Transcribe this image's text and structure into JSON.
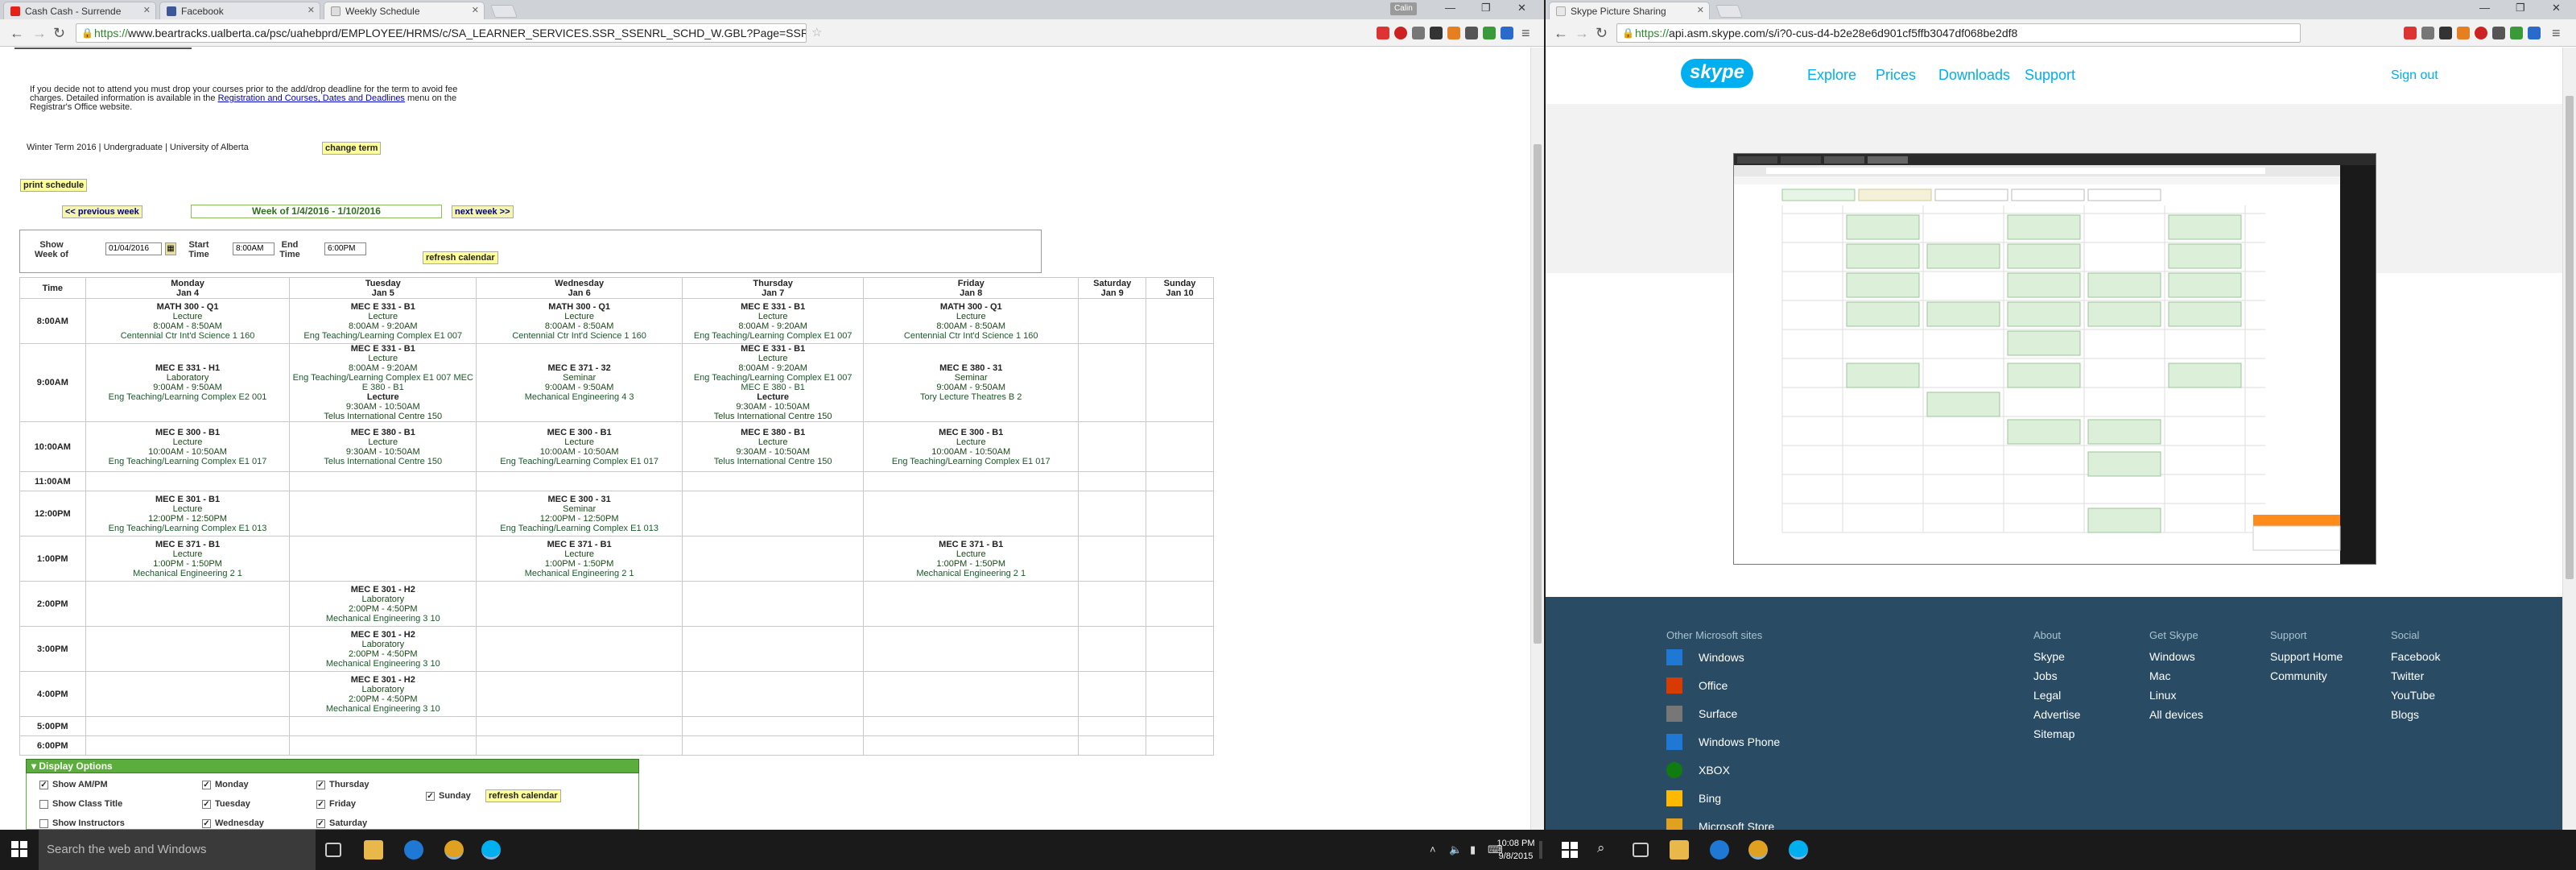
{
  "left_window": {
    "tabs": [
      {
        "label": "Cash Cash - Surrende",
        "icon_color": "#e62117"
      },
      {
        "label": "Facebook",
        "icon_color": "#3b5998"
      },
      {
        "label": "Weekly Schedule",
        "icon_color": "#cccccc"
      }
    ],
    "user_badge": "Calin",
    "url_https": "https://",
    "url_rest": "www.beartracks.ualberta.ca/psc/uahebprd/EMPLOYEE/HRMS/c/SA_LEARNER_SERVICES.SSR_SSENRL_SCHD_W.GBL?Page=SSR_SS_WEEK&Action=A&ExactKeys=Y&ACAD_CAREER=UGRD&AS_OF_DATE=2016-01-04"
  },
  "page": {
    "intro_1": "If you decide not to attend you must drop your courses prior to the add/drop deadline for the term to avoid fee",
    "intro_2": "charges. Detailed information is available in the ",
    "intro_link": "Registration and Courses, Dates and Deadlines",
    "intro_3": " menu on the",
    "intro_4": "Registrar's Office website.",
    "term": "Winter Term 2016 | Undergraduate | University of Alberta",
    "change_term": "change term",
    "print_schedule": "print schedule",
    "prev_week": "<< previous week",
    "week_of": "Week of 1/4/2016 - 1/10/2016",
    "next_week": "next week >>",
    "show_week_label": "Show Week of",
    "show_week_value": "01/04/2016",
    "start_time_label": "Start Time",
    "start_time_value": "8:00AM",
    "end_time_label": "End Time",
    "end_time_value": "6:00PM",
    "refresh": "refresh calendar"
  },
  "schedule": {
    "time_header": "Time",
    "days": [
      {
        "name": "Monday",
        "date": "Jan 4"
      },
      {
        "name": "Tuesday",
        "date": "Jan 5"
      },
      {
        "name": "Wednesday",
        "date": "Jan 6"
      },
      {
        "name": "Thursday",
        "date": "Jan 7"
      },
      {
        "name": "Friday",
        "date": "Jan 8"
      },
      {
        "name": "Saturday",
        "date": "Jan 9"
      },
      {
        "name": "Sunday",
        "date": "Jan 10"
      }
    ],
    "rows": [
      {
        "time": "8:00AM",
        "cells": [
          [
            "MATH 300 - Q1",
            "Lecture",
            "8:00AM - 8:50AM",
            "Centennial Ctr Int'd Science 1 160"
          ],
          [
            "MEC E 331 - B1",
            "Lecture",
            "8:00AM - 9:20AM",
            "Eng Teaching/Learning Complex E1 007"
          ],
          [
            "MATH 300 - Q1",
            "Lecture",
            "8:00AM - 8:50AM",
            "Centennial Ctr Int'd Science 1 160"
          ],
          [
            "MEC E 331 - B1",
            "Lecture",
            "8:00AM - 9:20AM",
            "Eng Teaching/Learning Complex E1 007"
          ],
          [
            "MATH 300 - Q1",
            "Lecture",
            "8:00AM - 8:50AM",
            "Centennial Ctr Int'd Science 1 160"
          ],
          [],
          []
        ]
      },
      {
        "time": "9:00AM",
        "cells": [
          [
            "MEC E 331 - H1",
            "Laboratory",
            "9:00AM - 9:50AM",
            "Eng Teaching/Learning Complex E2 001"
          ],
          [
            "MEC E 331 - B1",
            "Lecture",
            "8:00AM - 9:20AM",
            "Eng Teaching/Learning Complex E1 007 MEC E 380 - B1",
            "Lecture",
            "9:30AM - 10:50AM",
            "Telus International Centre 150"
          ],
          [
            "MEC E 371 - 32",
            "Seminar",
            "9:00AM - 9:50AM",
            "Mechanical Engineering 4 3"
          ],
          [
            "MEC E 331 - B1",
            "Lecture",
            "8:00AM - 9:20AM",
            "Eng Teaching/Learning Complex E1 007 MEC E 380 - B1",
            "Lecture",
            "9:30AM - 10:50AM",
            "Telus International Centre 150"
          ],
          [
            "MEC E 380 - 31",
            "Seminar",
            "9:00AM - 9:50AM",
            "Tory Lecture Theatres B 2"
          ],
          [],
          []
        ]
      },
      {
        "time": "10:00AM",
        "cells": [
          [
            "MEC E 300 - B1",
            "Lecture",
            "10:00AM - 10:50AM",
            "Eng Teaching/Learning Complex E1 017"
          ],
          [
            "MEC E 380 - B1",
            "Lecture",
            "9:30AM - 10:50AM",
            "Telus International Centre 150"
          ],
          [
            "MEC E 300 - B1",
            "Lecture",
            "10:00AM - 10:50AM",
            "Eng Teaching/Learning Complex E1 017"
          ],
          [
            "MEC E 380 - B1",
            "Lecture",
            "9:30AM - 10:50AM",
            "Telus International Centre 150"
          ],
          [
            "MEC E 300 - B1",
            "Lecture",
            "10:00AM - 10:50AM",
            "Eng Teaching/Learning Complex E1 017"
          ],
          [],
          []
        ]
      },
      {
        "time": "11:00AM",
        "cells": [
          [],
          [],
          [],
          [],
          [],
          [],
          []
        ]
      },
      {
        "time": "12:00PM",
        "cells": [
          [
            "MEC E 301 - B1",
            "Lecture",
            "12:00PM - 12:50PM",
            "Eng Teaching/Learning Complex E1 013"
          ],
          [],
          [
            "MEC E 300 - 31",
            "Seminar",
            "12:00PM - 12:50PM",
            "Eng Teaching/Learning Complex E1 013"
          ],
          [],
          [],
          [],
          []
        ]
      },
      {
        "time": "1:00PM",
        "cells": [
          [
            "MEC E 371 - B1",
            "Lecture",
            "1:00PM - 1:50PM",
            "Mechanical Engineering 2 1"
          ],
          [],
          [
            "MEC E 371 - B1",
            "Lecture",
            "1:00PM - 1:50PM",
            "Mechanical Engineering 2 1"
          ],
          [],
          [
            "MEC E 371 - B1",
            "Lecture",
            "1:00PM - 1:50PM",
            "Mechanical Engineering 2 1"
          ],
          [],
          []
        ]
      },
      {
        "time": "2:00PM",
        "cells": [
          [],
          [
            "MEC E 301 - H2",
            "Laboratory",
            "2:00PM - 4:50PM",
            "Mechanical Engineering 3 10"
          ],
          [],
          [],
          [],
          [],
          []
        ]
      },
      {
        "time": "3:00PM",
        "cells": [
          [],
          [
            "MEC E 301 - H2",
            "Laboratory",
            "2:00PM - 4:50PM",
            "Mechanical Engineering 3 10"
          ],
          [],
          [],
          [],
          [],
          []
        ]
      },
      {
        "time": "4:00PM",
        "cells": [
          [],
          [
            "MEC E 301 - H2",
            "Laboratory",
            "2:00PM - 4:50PM",
            "Mechanical Engineering 3 10"
          ],
          [],
          [],
          [],
          [],
          []
        ]
      },
      {
        "time": "5:00PM",
        "cells": [
          [],
          [],
          [],
          [],
          [],
          [],
          []
        ]
      },
      {
        "time": "6:00PM",
        "cells": [
          [],
          [],
          [],
          [],
          [],
          [],
          []
        ]
      }
    ]
  },
  "options": {
    "title": "Display Options",
    "items": [
      {
        "label": "Show AM/PM",
        "checked": true
      },
      {
        "label": "Show Class Title",
        "checked": false
      },
      {
        "label": "Show Instructors",
        "checked": false
      },
      {
        "label": "Monday",
        "checked": true
      },
      {
        "label": "Tuesday",
        "checked": true
      },
      {
        "label": "Wednesday",
        "checked": true
      },
      {
        "label": "Thursday",
        "checked": true
      },
      {
        "label": "Friday",
        "checked": true
      },
      {
        "label": "Saturday",
        "checked": true
      },
      {
        "label": "Sunday",
        "checked": true
      }
    ],
    "refresh": "refresh calendar"
  },
  "right_window": {
    "tab": "Skype Picture Sharing",
    "url_https": "https://",
    "url_rest": "api.asm.skype.com/s/i?0-cus-d4-b2e28e6d901cf5ffb3047df068be2df8",
    "nav": [
      "Explore",
      "Prices",
      "Downloads",
      "Support"
    ],
    "signout": "Sign out",
    "footer": {
      "ms_title": "Other Microsoft sites",
      "ms_sites": [
        "Windows",
        "Office",
        "Surface",
        "Windows Phone",
        "XBOX",
        "Bing",
        "Microsoft Store"
      ],
      "cols": [
        {
          "title": "About",
          "links": [
            "Skype",
            "Jobs",
            "Legal",
            "Advertise",
            "Sitemap"
          ]
        },
        {
          "title": "Get Skype",
          "links": [
            "Windows",
            "Mac",
            "Linux",
            "All devices"
          ]
        },
        {
          "title": "Support",
          "links": [
            "Support Home",
            "Community"
          ]
        },
        {
          "title": "Social",
          "links": [
            "Facebook",
            "Twitter",
            "YouTube",
            "Blogs"
          ]
        }
      ]
    }
  },
  "taskbar": {
    "search": "Search the web and Windows",
    "time": "10:08 PM",
    "date": "9/8/2015"
  },
  "colors": {
    "skype_blue": "#00aff0",
    "footer_bg": "#294b63",
    "ps_green": "#5cae3c"
  }
}
